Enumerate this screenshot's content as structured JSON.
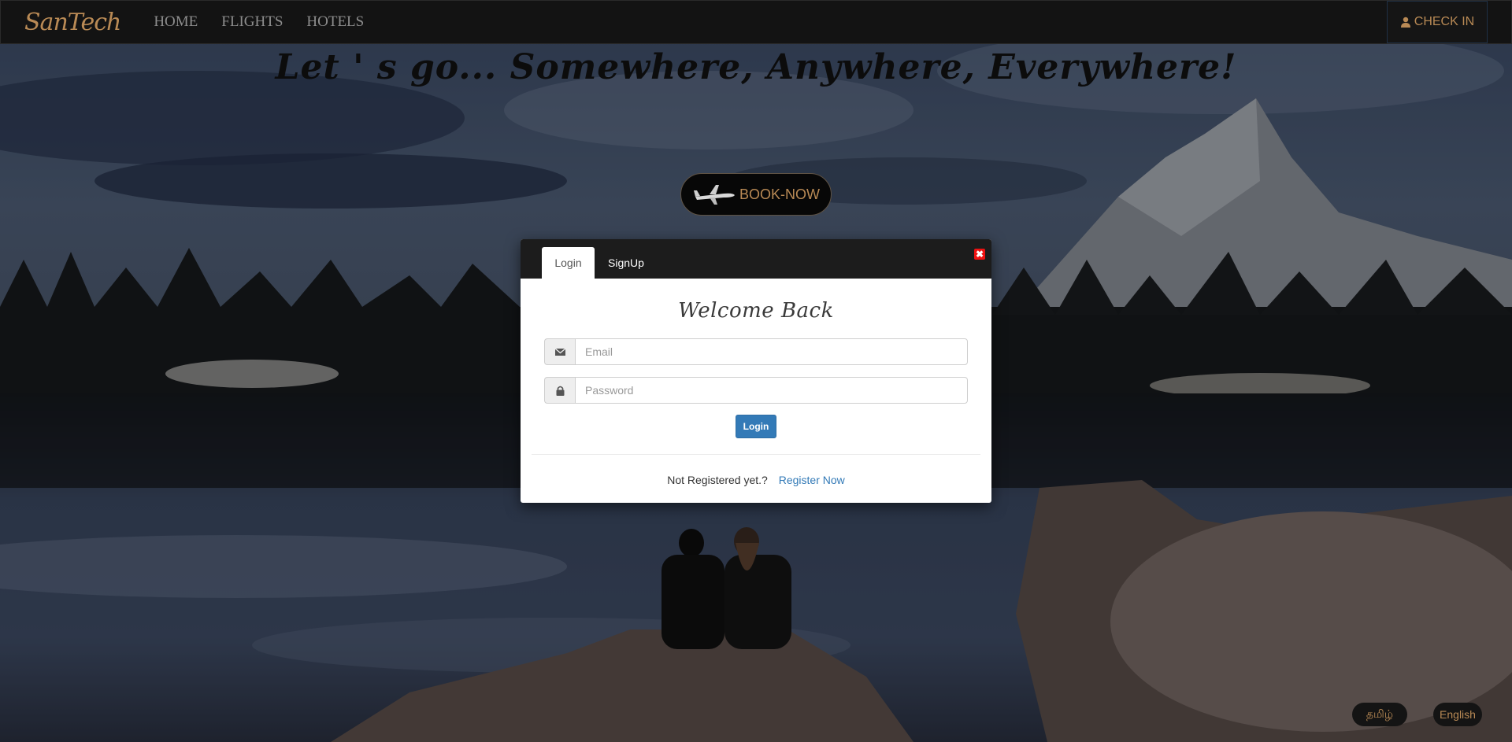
{
  "navbar": {
    "brand": "SanTech",
    "links": [
      "HOME",
      "FLIGHTS",
      "HOTELS"
    ],
    "checkin_label": "CHECK IN"
  },
  "hero": {
    "headline": "Let ' s go... Somewhere, Anywhere, Everywhere!",
    "book_now_label": "BOOK-NOW"
  },
  "modal": {
    "tabs": [
      "Login",
      "SignUp"
    ],
    "active_tab": "Login",
    "close_symbol": "✖",
    "title": "Welcome Back",
    "email_placeholder": "Email",
    "password_placeholder": "Password",
    "login_button": "Login",
    "not_registered_text": "Not Registered yet.?",
    "register_link": "Register Now"
  },
  "languages": [
    "தமிழ்",
    "English"
  ],
  "colors": {
    "accent_gold": "#b98a55",
    "primary_blue": "#337ab7",
    "navbar_bg": "#131313",
    "modal_header_bg": "#1c1c1c"
  },
  "icons": {
    "checkin": "user-icon",
    "email": "envelope-icon",
    "password": "lock-icon",
    "book_now": "airplane-icon",
    "close": "close-icon"
  }
}
